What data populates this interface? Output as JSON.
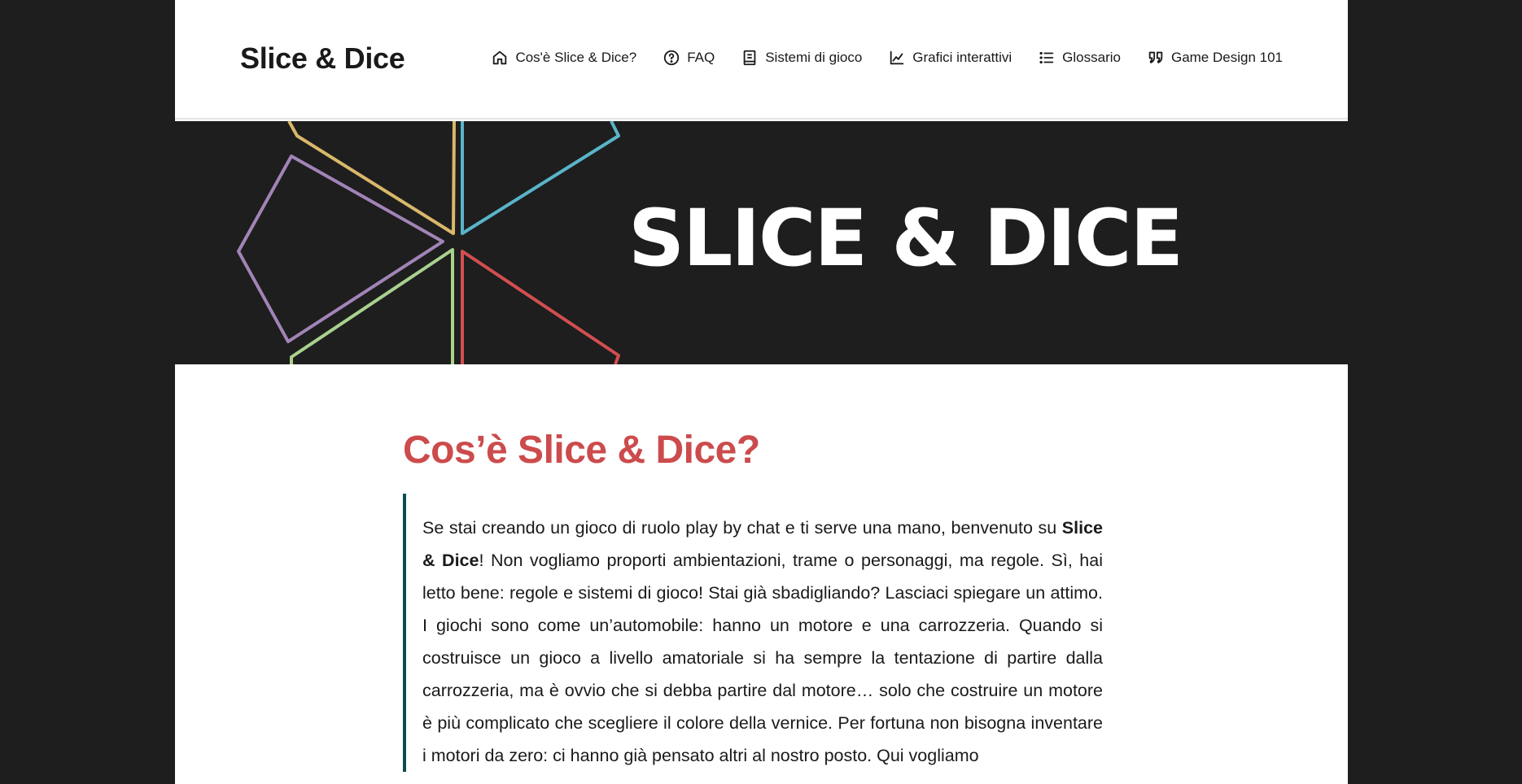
{
  "header": {
    "site_title": "Slice & Dice",
    "nav": [
      {
        "label": "Cos'è Slice & Dice?",
        "icon": "home-icon"
      },
      {
        "label": "FAQ",
        "icon": "help-circle-icon"
      },
      {
        "label": "Sistemi di gioco",
        "icon": "book-icon"
      },
      {
        "label": "Grafici interattivi",
        "icon": "chart-line-icon"
      },
      {
        "label": "Glossario",
        "icon": "list-icon"
      },
      {
        "label": "Game Design 101",
        "icon": "quote-icon"
      }
    ]
  },
  "hero": {
    "title": "SLICE & DICE",
    "logo_icon": "slice-logo-icon",
    "colors": {
      "background": "#1e1e1e",
      "yellow": "#d9b86a",
      "blue": "#5ab4c9",
      "purple": "#a284b8",
      "green": "#a9d18e",
      "red": "#d24e50"
    }
  },
  "main": {
    "heading": "Cos’è Slice & Dice?",
    "intro": {
      "part1": "Se stai creando un gioco di ruolo play by chat e ti serve una mano, benvenuto su ",
      "bold": "Slice & Dice",
      "part2": "! Non vogliamo proporti ambientazioni, trame o personaggi, ma regole. Sì, hai letto bene: regole e sistemi di gioco! Stai già sbadigliando? Lasciaci spiegare un attimo. I giochi sono come un’automobile: hanno un motore e una carrozzeria. Quando si costruisce un gioco a livello amatoriale si ha sempre la tentazione di partire dalla carrozzeria, ma è ovvio che si debba partire dal motore… solo che costruire un motore è più complicato che scegliere il colore della vernice. Per fortuna non bisogna inventare i motori da zero: ci hanno già pensato altri al nostro posto. Qui vogliamo"
    }
  },
  "colors": {
    "accent_red": "#cc4b4c",
    "quote_bar": "#0e4a56",
    "outer_background": "#1e1e1e"
  }
}
